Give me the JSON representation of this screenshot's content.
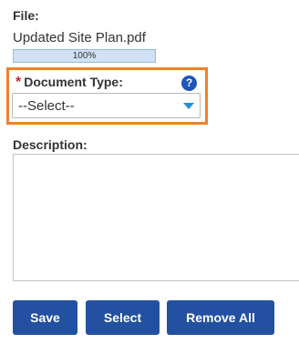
{
  "file": {
    "label": "File:",
    "name": "Updated Site Plan.pdf",
    "progress_percent": 100,
    "progress_text": "100%"
  },
  "document_type": {
    "required_marker": "*",
    "label": "Document Type:",
    "help_icon": "?",
    "selected_value": "--Select--"
  },
  "description": {
    "label": "Description:",
    "value": ""
  },
  "buttons": {
    "save": "Save",
    "select": "Select",
    "remove_all": "Remove All"
  },
  "colors": {
    "button_bg": "#2350a0",
    "highlight_border": "#f0812a",
    "required_star": "#d0202a",
    "help_icon_bg": "#1d56b6",
    "caret": "#1f8fd8"
  }
}
